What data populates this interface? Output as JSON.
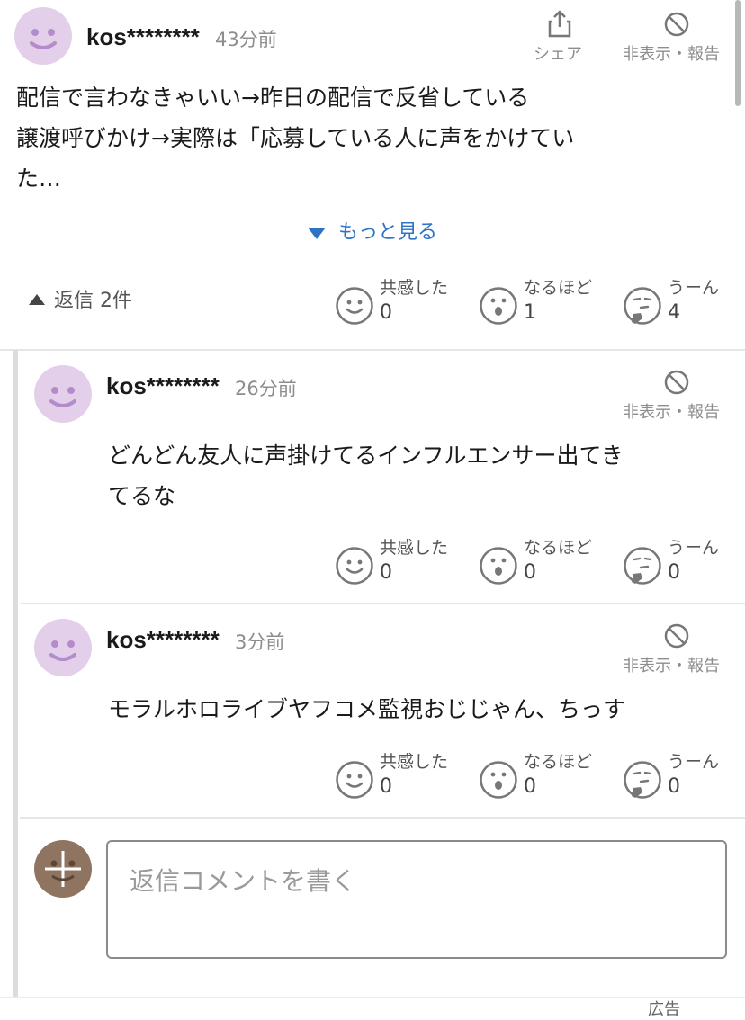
{
  "main_comment": {
    "user": "kos********",
    "time": "43分前",
    "share_label": "シェア",
    "hide_label": "非表示・報告",
    "text_lines": [
      "配信で言わなきゃいい→昨日の配信で反省している",
      "譲渡呼びかけ→実際は「応募している人に声をかけてい",
      "た…"
    ],
    "more_label": "もっと見る",
    "replies_toggle": "返信 2件",
    "reactions": [
      {
        "label": "共感した",
        "count": "0",
        "icon": "smile-face-icon"
      },
      {
        "label": "なるほど",
        "count": "1",
        "icon": "surprised-face-icon"
      },
      {
        "label": "うーん",
        "count": "4",
        "icon": "thinking-face-icon"
      }
    ]
  },
  "replies": [
    {
      "user": "kos********",
      "time": "26分前",
      "hide_label": "非表示・報告",
      "text_lines": [
        "どんどん友人に声掛けてるインフルエンサー出てき",
        "てるな"
      ],
      "reactions": [
        {
          "label": "共感した",
          "count": "0"
        },
        {
          "label": "なるほど",
          "count": "0"
        },
        {
          "label": "うーん",
          "count": "0"
        }
      ]
    },
    {
      "user": "kos********",
      "time": "3分前",
      "hide_label": "非表示・報告",
      "text_lines": [
        "モラルホロライブヤフコメ監視おじじゃん、ちっす"
      ],
      "reactions": [
        {
          "label": "共感した",
          "count": "0"
        },
        {
          "label": "なるほど",
          "count": "0"
        },
        {
          "label": "うーん",
          "count": "0"
        }
      ]
    }
  ],
  "reply_input": {
    "placeholder": "返信コメントを書く"
  },
  "ad_label": "広告",
  "colors": {
    "link": "#2f73c4",
    "avatar_bg": "#e3cfe9",
    "avatar_face": "#b48ccb",
    "muted": "#8d8d8d"
  }
}
